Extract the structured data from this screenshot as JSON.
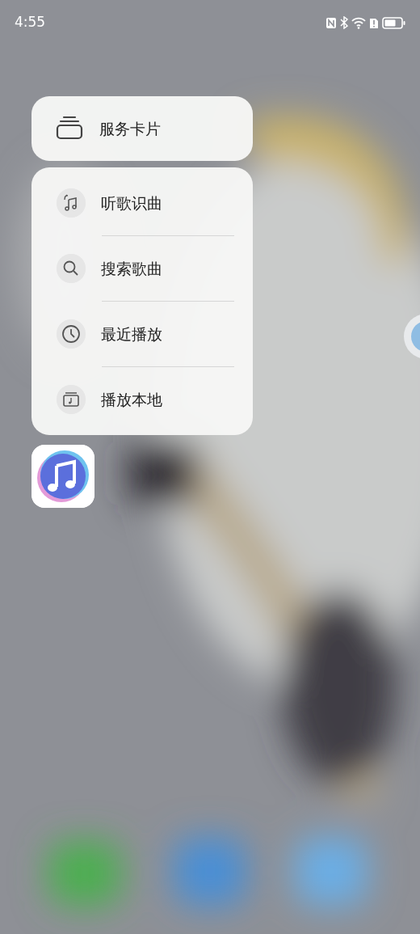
{
  "status_bar": {
    "time": "4:55"
  },
  "card_action": {
    "label": "服务卡片"
  },
  "menu_items": [
    {
      "label": "听歌识曲"
    },
    {
      "label": "搜索歌曲"
    },
    {
      "label": "最近播放"
    },
    {
      "label": "播放本地"
    }
  ]
}
